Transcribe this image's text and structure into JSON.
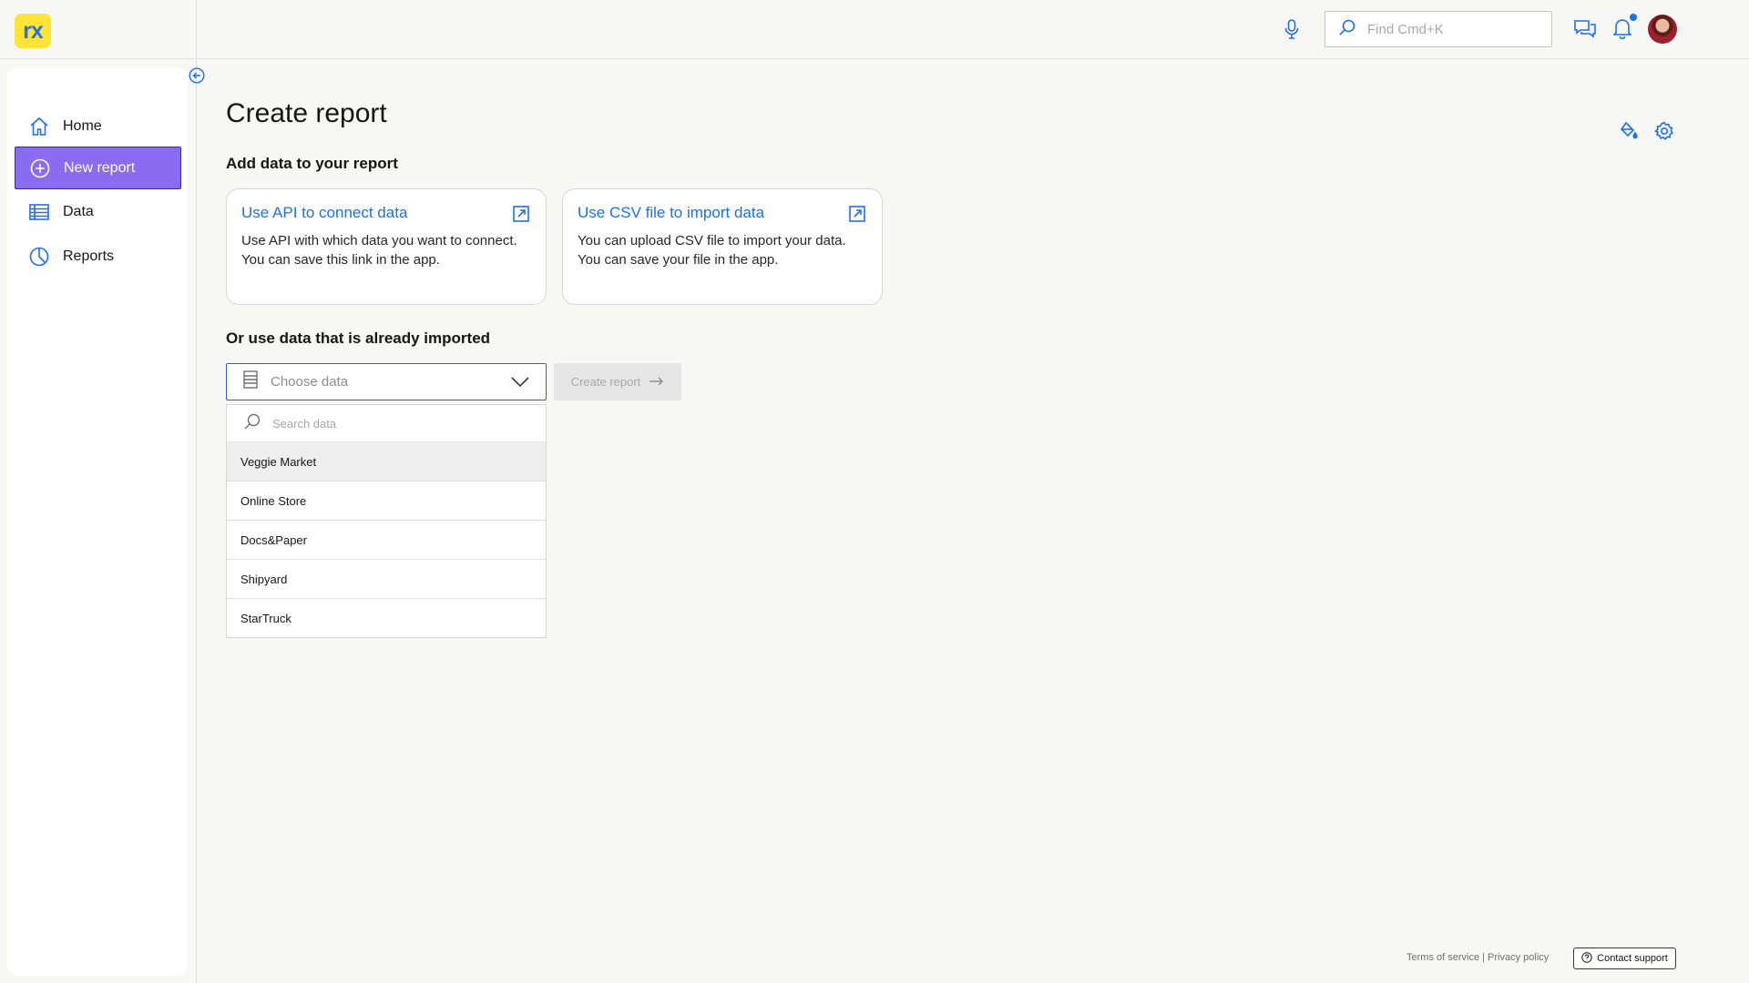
{
  "app": {
    "logo_text": "rx"
  },
  "header": {
    "search_placeholder": "Find Cmd+K",
    "icons": [
      "microphone-icon",
      "search-icon",
      "chat-icon",
      "bell-icon",
      "avatar"
    ],
    "notification_dot_color": "#1f6fe6"
  },
  "sidebar": {
    "items": [
      {
        "label": "Home",
        "icon": "home-icon",
        "active": false
      },
      {
        "label": "New report",
        "icon": "add-circle-icon",
        "active": true
      },
      {
        "label": "Data",
        "icon": "table-icon",
        "active": false
      },
      {
        "label": "Reports",
        "icon": "pie-chart-icon",
        "active": false
      }
    ],
    "active_color": "#8a6cf0"
  },
  "main": {
    "title": "Create report",
    "add_data_heading": "Add data to your report",
    "cards": [
      {
        "title": "Use API to connect data",
        "desc_line1": "Use API with which data you want to connect.",
        "desc_line2": "You can save this link in the app."
      },
      {
        "title": "Use CSV file to import data",
        "desc_line1": "You can upload CSV file to import your data.",
        "desc_line2": "You can save your file in the app."
      }
    ],
    "existing_heading": "Or use data that is already imported",
    "select_placeholder": "Choose data",
    "create_button": "Create report",
    "dropdown": {
      "search_placeholder": "Search data",
      "options": [
        "Veggie Market",
        "Online Store",
        "Docs&Paper",
        "Shipyard",
        "StarTruck"
      ],
      "highlighted": "Veggie Market"
    }
  },
  "footer": {
    "links": "Terms of service | Privacy policy",
    "contact": "Contact support"
  },
  "colors": {
    "accent_blue": "#1f6fe6",
    "logo_yellow": "#ffe438"
  }
}
